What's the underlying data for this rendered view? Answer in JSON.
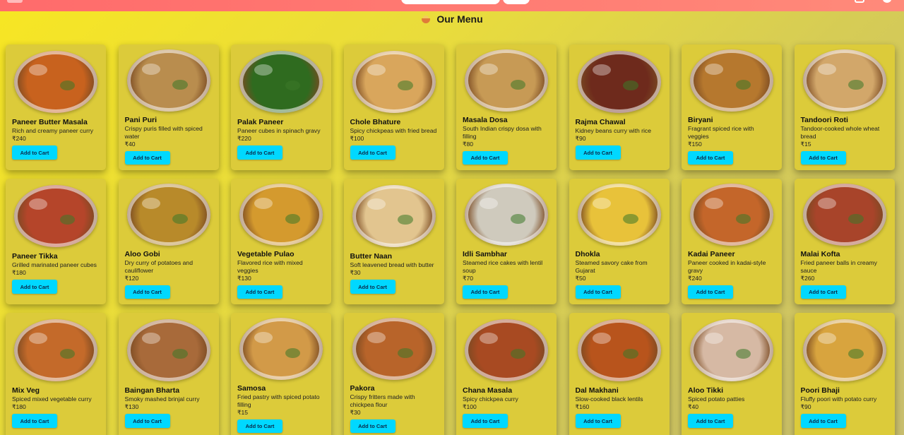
{
  "header": {
    "brand": "",
    "menu_title": "Our Menu"
  },
  "items": [
    {
      "name": "Paneer Butter Masala",
      "desc": "Rich and creamy paneer curry",
      "price": "₹240",
      "button": "Add to Cart",
      "color": "#c8621e"
    },
    {
      "name": "Pani Puri",
      "desc": "Crispy puris filled with spiced water",
      "price": "₹40",
      "button": "Add to Cart",
      "color": "#b98d4e"
    },
    {
      "name": "Palak Paneer",
      "desc": "Paneer cubes in spinach gravy",
      "price": "₹220",
      "button": "Add to Cart",
      "color": "#2f6b1f"
    },
    {
      "name": "Chole Bhature",
      "desc": "Spicy chickpeas with fried bread",
      "price": "₹100",
      "button": "Add to Cart",
      "color": "#d9a65c"
    },
    {
      "name": "Masala Dosa",
      "desc": "South Indian crispy dosa with filling",
      "price": "₹80",
      "button": "Add to Cart",
      "color": "#c79a55"
    },
    {
      "name": "Rajma Chawal",
      "desc": "Kidney beans curry with rice",
      "price": "₹90",
      "button": "Add to Cart",
      "color": "#6e2a1c"
    },
    {
      "name": "Biryani",
      "desc": "Fragrant spiced rice with veggies",
      "price": "₹150",
      "button": "Add to Cart",
      "color": "#b6782e"
    },
    {
      "name": "Tandoori Roti",
      "desc": "Tandoor-cooked whole wheat bread",
      "price": "₹15",
      "button": "Add to Cart",
      "color": "#d2a76a"
    },
    {
      "name": "Paneer Tikka",
      "desc": "Grilled marinated paneer cubes",
      "price": "₹180",
      "button": "Add to Cart",
      "color": "#b5452a"
    },
    {
      "name": "Aloo Gobi",
      "desc": "Dry curry of potatoes and cauliflower",
      "price": "₹120",
      "button": "Add to Cart",
      "color": "#b88a2a"
    },
    {
      "name": "Vegetable Pulao",
      "desc": "Flavored rice with mixed veggies",
      "price": "₹130",
      "button": "Add to Cart",
      "color": "#d49a2e"
    },
    {
      "name": "Butter Naan",
      "desc": "Soft leavened bread with butter",
      "price": "₹30",
      "button": "Add to Cart",
      "color": "#e2c58f"
    },
    {
      "name": "Idli Sambhar",
      "desc": "Steamed rice cakes with lentil soup",
      "price": "₹70",
      "button": "Add to Cart",
      "color": "#cfcabd"
    },
    {
      "name": "Dhokla",
      "desc": "Steamed savory cake from Gujarat",
      "price": "₹50",
      "button": "Add to Cart",
      "color": "#e8c23a"
    },
    {
      "name": "Kadai Paneer",
      "desc": "Paneer cooked in kadai-style gravy",
      "price": "₹240",
      "button": "Add to Cart",
      "color": "#c4662a"
    },
    {
      "name": "Malai Kofta",
      "desc": "Fried paneer balls in creamy sauce",
      "price": "₹260",
      "button": "Add to Cart",
      "color": "#a8442a"
    },
    {
      "name": "Mix Veg",
      "desc": "Spiced mixed vegetable curry",
      "price": "₹180",
      "button": "Add to Cart",
      "color": "#c46a2a"
    },
    {
      "name": "Baingan Bharta",
      "desc": "Smoky mashed brinjal curry",
      "price": "₹130",
      "button": "Add to Cart",
      "color": "#a86a3a"
    },
    {
      "name": "Samosa",
      "desc": "Fried pastry with spiced potato filling",
      "price": "₹15",
      "button": "Add to Cart",
      "color": "#d29a48"
    },
    {
      "name": "Pakora",
      "desc": "Crispy fritters made with chickpea flour",
      "price": "₹30",
      "button": "Add to Cart",
      "color": "#b8642a"
    },
    {
      "name": "Chana Masala",
      "desc": "Spicy chickpea curry",
      "price": "₹100",
      "button": "Add to Cart",
      "color": "#a84a22"
    },
    {
      "name": "Dal Makhani",
      "desc": "Slow-cooked black lentils",
      "price": "₹160",
      "button": "Add to Cart",
      "color": "#b8541c"
    },
    {
      "name": "Aloo Tikki",
      "desc": "Spiced potato patties",
      "price": "₹40",
      "button": "Add to Cart",
      "color": "#d6b9a4"
    },
    {
      "name": "Poori Bhaji",
      "desc": "Fluffy poori with potato curry",
      "price": "₹90",
      "button": "Add to Cart",
      "color": "#d8a43e"
    }
  ]
}
